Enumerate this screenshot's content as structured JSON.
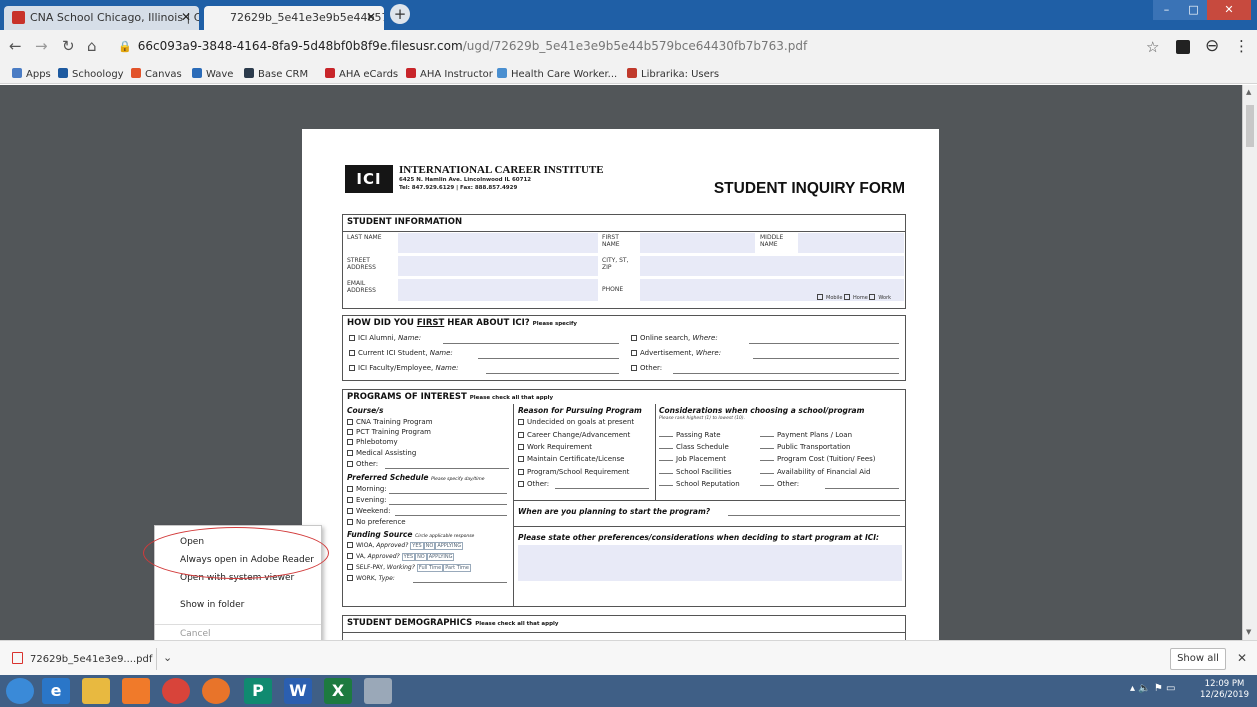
{
  "tabs": [
    {
      "title": "CNA School Chicago, Illinois | Ce"
    },
    {
      "title": "72629b_5e41e3e9b5e44b579bc"
    }
  ],
  "address": {
    "host": "66c093a9-3848-4164-8fa9-5d48bf0b8f9e.filesusr.com",
    "path": "/ugd/72629b_5e41e3e9b5e44b579bce64430fb7b763.pdf"
  },
  "bookmarks": [
    {
      "label": "Apps",
      "color": "#4a7cc4"
    },
    {
      "label": "Schoology",
      "color": "#1d5aa0"
    },
    {
      "label": "Canvas",
      "color": "#e2532a"
    },
    {
      "label": "Wave",
      "color": "#2a6bb8"
    },
    {
      "label": "Base CRM",
      "color": "#2c3b4c"
    },
    {
      "label": "AHA eCards",
      "color": "#c8252a"
    },
    {
      "label": "AHA Instructor",
      "color": "#c8252a"
    },
    {
      "label": "Health Care Worker...",
      "color": "#4a8fd0"
    },
    {
      "label": "Librarika: Users",
      "color": "#c0392b"
    }
  ],
  "form": {
    "logo": "ICI",
    "institute_name": "INTERNATIONAL CAREER INSTITUTE",
    "institute_address": "6425 N. Hamlin Ave. Lincolnwood IL 60712",
    "institute_phone": "Tel: 847.929.6129 | Fax: 888.857.4929",
    "title": "STUDENT INQUIRY FORM",
    "student_info": {
      "heading": "STUDENT INFORMATION",
      "last_name": "LAST NAME",
      "first_name": "FIRST NAME",
      "middle_name": "MIDDLE NAME",
      "street": "STREET ADDRESS",
      "city": "CITY, ST, ZIP",
      "email": "EMAIL ADDRESS",
      "phone": "PHONE",
      "phone_types": [
        "Mobile",
        "Home",
        "Work"
      ]
    },
    "hear": {
      "heading_pre": "HOW DID YOU ",
      "heading_first": "FIRST",
      "heading_post": " HEAR ABOUT ICI?",
      "note": "Please specify",
      "left": [
        {
          "label": "ICI Alumni, ",
          "italic": "Name:"
        },
        {
          "label": "Current ICI Student, ",
          "italic": "Name:"
        },
        {
          "label": "ICI Faculty/Employee, ",
          "italic": "Name:"
        }
      ],
      "right": [
        {
          "label": "Online search, ",
          "italic": "Where:"
        },
        {
          "label": "Advertisement, ",
          "italic": "Where:"
        },
        {
          "label": "Other:",
          "italic": ""
        }
      ]
    },
    "programs": {
      "heading": "PROGRAMS OF INTEREST",
      "note": "Please check all that apply",
      "course_heading": "Course/s",
      "courses": [
        "CNA Training Program",
        "PCT Training Program",
        "Phlebotomy",
        "Medical Assisting",
        "Other:"
      ],
      "reason_heading": "Reason for Pursuing Program",
      "reasons": [
        "Undecided on goals at present",
        "Career Change/Advancement",
        "Work Requirement",
        "Maintain Certificate/License",
        "Program/School Requirement",
        "Other:"
      ],
      "consider_heading": "Considerations when choosing a school/program",
      "consider_note": "Please rank highest (1) to lowest (10).",
      "consider_left": [
        "Passing Rate",
        "Class Schedule",
        "Job Placement",
        "School Facilities",
        "School Reputation"
      ],
      "consider_right": [
        "Payment Plans / Loan",
        "Public Transportation",
        "Program Cost (Tuition/ Fees)",
        "Availability of Financial Aid",
        "Other:"
      ],
      "schedule_heading": "Preferred Schedule",
      "schedule_note": "Please specify day/time",
      "schedules": [
        "Morning:",
        "Evening:",
        "Weekend:",
        "No preference"
      ],
      "start_question": "When are you planning to start the program?",
      "preferences_question": "Please state other preferences/considerations when deciding to start program at ICI:",
      "funding_heading": "Funding Source",
      "funding_note": "Circle applicable response",
      "funding": [
        {
          "label": "WIOA, ",
          "italic": "Approved?",
          "opts": [
            "YES",
            "NO",
            "APPLYING"
          ]
        },
        {
          "label": "VA, ",
          "italic": "Approved?",
          "opts": [
            "YES",
            "NO",
            "APPLYING"
          ]
        },
        {
          "label": "SELF-PAY, ",
          "italic": "Working?",
          "opts": [
            "Full Time",
            "Part Time"
          ]
        },
        {
          "label": "WORK, ",
          "italic": "Type:",
          "opts": []
        }
      ]
    },
    "demographics": {
      "heading": "STUDENT DEMOGRAPHICS",
      "note": "Please check all that apply"
    }
  },
  "context_menu": {
    "items": [
      "Open",
      "Always open in Adobe Reader",
      "Open with system viewer",
      "Show in folder",
      "Cancel"
    ]
  },
  "download": {
    "filename": "72629b_5e41e3e9....pdf",
    "show_all": "Show all"
  },
  "taskbar": {
    "apps": [
      {
        "name": "start",
        "color": "#3a8ad8",
        "glyph": ""
      },
      {
        "name": "ie",
        "color": "#2a76c8",
        "glyph": "e"
      },
      {
        "name": "explorer",
        "color": "#e8b940",
        "glyph": ""
      },
      {
        "name": "media",
        "color": "#f07a2a",
        "glyph": ""
      },
      {
        "name": "chrome",
        "color": "#d8443a",
        "glyph": ""
      },
      {
        "name": "firefox",
        "color": "#e8742a",
        "glyph": ""
      },
      {
        "name": "publisher",
        "color": "#108a70",
        "glyph": "P"
      },
      {
        "name": "word",
        "color": "#2b5fb0",
        "glyph": "W"
      },
      {
        "name": "excel",
        "color": "#1d7a40",
        "glyph": "X"
      },
      {
        "name": "stack",
        "color": "#9aa8b8",
        "glyph": ""
      }
    ],
    "time": "12:09 PM",
    "date": "12/26/2019"
  }
}
